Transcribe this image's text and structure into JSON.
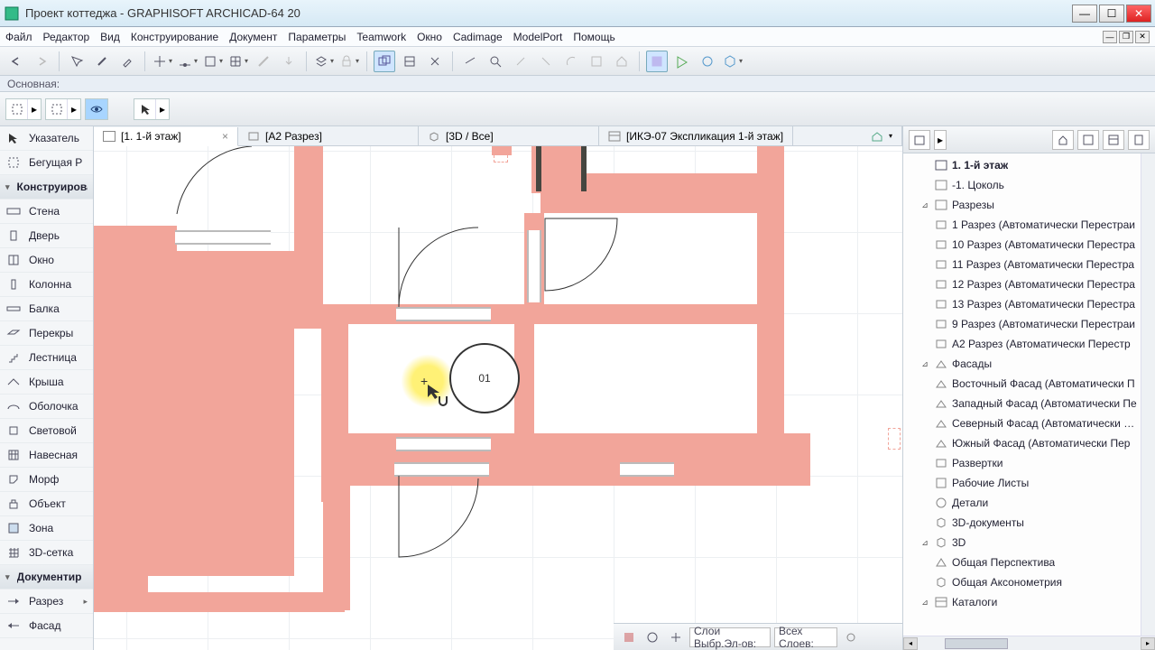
{
  "titlebar": {
    "title": "Проект коттеджа - GRAPHISOFT ARCHICAD-64 20"
  },
  "menu": {
    "file": "Файл",
    "edit": "Редактор",
    "view": "Вид",
    "design": "Конструирование",
    "document": "Документ",
    "options": "Параметры",
    "teamwork": "Teamwork",
    "window": "Окно",
    "cadimage": "Cadimage",
    "modelport": "ModelPort",
    "help": "Помощь"
  },
  "infobar": {
    "label": "Основная:"
  },
  "tabs": {
    "t1": "[1. 1-й этаж]",
    "t2": "[А2 Разрез]",
    "t3": "[3D / Все]",
    "t4": "[ИКЭ-07 Экспликация 1-й этаж]"
  },
  "toolbox": {
    "arrow": "Указатель",
    "marquee": "Бегущая Р",
    "design_header": "Конструирова",
    "wall": "Стена",
    "door": "Дверь",
    "window": "Окно",
    "column": "Колонна",
    "beam": "Балка",
    "slab": "Перекры",
    "stair": "Лестница",
    "roof": "Крыша",
    "shell": "Оболочка",
    "skylight": "Световой",
    "curtain": "Навесная",
    "morph": "Морф",
    "object": "Объект",
    "zone": "Зона",
    "mesh": "3D-сетка",
    "doc_header": "Документир",
    "section": "Разрез",
    "elevation": "Фасад"
  },
  "canvas": {
    "marker_label": "01"
  },
  "navigator": {
    "floor1": "1. 1-й этаж",
    "basement": "-1. Цоколь",
    "sections": "Разрезы",
    "s1": "1 Разрез (Автоматически Перестраи",
    "s10": "10 Разрез (Автоматически Перестра",
    "s11": "11 Разрез (Автоматически Перестра",
    "s12": "12 Разрез (Автоматически Перестра",
    "s13": "13 Разрез (Автоматически Перестра",
    "s9": "9 Разрез (Автоматически Перестраи",
    "sA2": "А2 Разрез (Автоматически Перестр",
    "elevations": "Фасады",
    "e_east": "Восточный Фасад (Автоматически П",
    "e_west": "Западный Фасад (Автоматически Пе",
    "e_north": "Северный Фасад (Автоматически Пе",
    "e_south": "Южный Фасад (Автоматически Пер",
    "interior": "Развертки",
    "worksheets": "Рабочие Листы",
    "details": "Детали",
    "docs3d": "3D-документы",
    "d3d": "3D",
    "persp": "Общая Перспектива",
    "axo": "Общая Аксонометрия",
    "catalogs": "Каталоги"
  },
  "bottombar": {
    "layer_label": "Слои Выбр.Эл-ов:",
    "layer_set": "Всех Слоев:"
  }
}
